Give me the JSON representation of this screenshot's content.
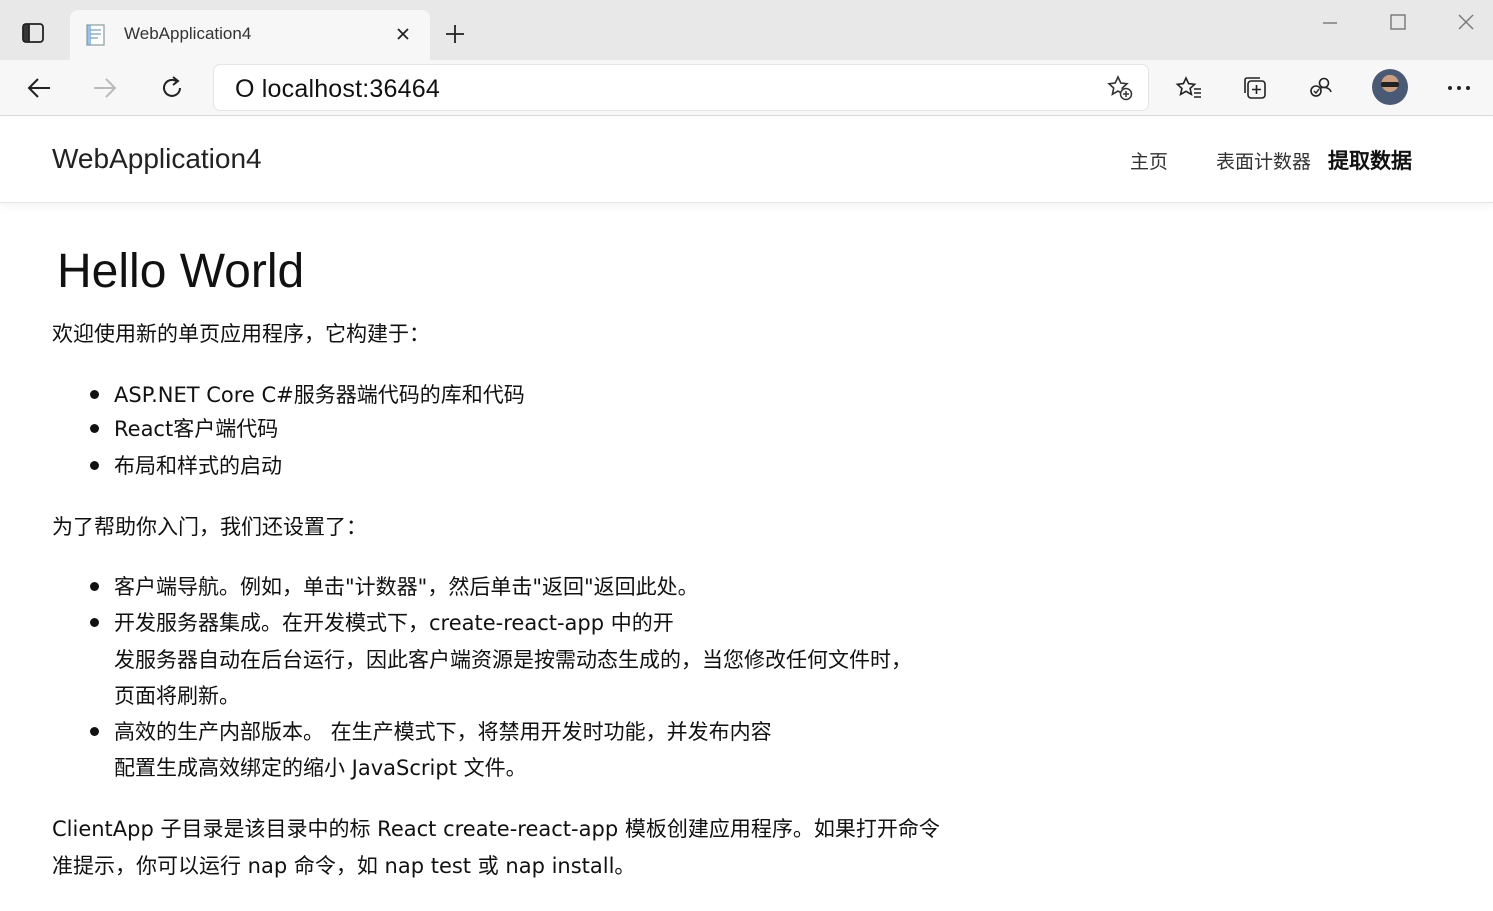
{
  "browser": {
    "tab_title": "WebApplication4",
    "address": "O localhost:36464",
    "icons": [
      "tab-actions-icon",
      "page-favicon-icon",
      "close-icon",
      "plus-icon",
      "minimize-icon",
      "maximize-icon",
      "window-close-icon",
      "back-icon",
      "forward-icon",
      "refresh-icon",
      "add-favorite-icon",
      "favorites-icon",
      "collections-icon",
      "profile-sync-icon",
      "avatar",
      "more-icon"
    ]
  },
  "header": {
    "brand": "WebApplication4",
    "nav": [
      "主页",
      "表面计数器",
      "提取数据"
    ]
  },
  "main": {
    "heading": "Hello World",
    "intro": "欢迎使用新的单页应用程序，它构建于：",
    "built_on": [
      "ASP.NET Core C#服务器端代码的库和代码",
      "React客户端代码",
      "布局和样式的启动"
    ],
    "setup_intro": "为了帮助你入门，我们还设置了：",
    "setup_items": [
      {
        "lines": [
          "客户端导航。例如，单击\"计数器\"，然后单击\"返回\"返回此处。"
        ]
      },
      {
        "lines": [
          "开发服务器集成。在开发模式下，create-react-app 中的开",
          "发服务器自动在后台运行，因此客户端资源是按需动态生成的，当您修改任何文件时，",
          "页面将刷新。"
        ]
      },
      {
        "lines": [
          "高效的生产内部版本。            在生产模式下，将禁用开发时功能，并发布内容",
          "配置生成高效绑定的缩小 JavaScript 文件。"
        ]
      }
    ],
    "footer_lines": [
      "ClientApp 子目录是该目录中的标                React create-react-app 模板创建应用程序。如果打开命令",
      "准提示，你可以运行 nap 命令，如 nap test 或 nap install。"
    ]
  }
}
